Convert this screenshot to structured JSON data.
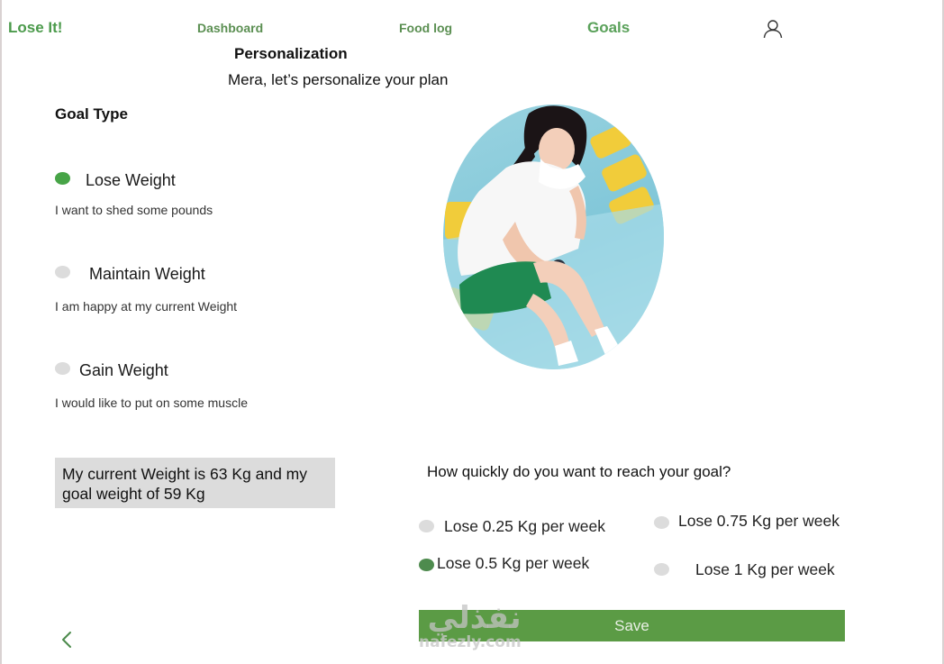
{
  "app": {
    "name": "Lose It!"
  },
  "nav": {
    "dashboard": "Dashboard",
    "food_log": "Food log",
    "goals": "Goals",
    "profile_icon": "user-icon"
  },
  "header": {
    "title": "Personalization",
    "subtitle": "Mera, let’s  personalize your plan"
  },
  "goal_type": {
    "title": "Goal Type",
    "options": [
      {
        "label": "Lose Weight",
        "description": "I want to shed some pounds",
        "selected": true
      },
      {
        "label": "Maintain Weight",
        "description": "I am happy at my current Weight",
        "selected": false
      },
      {
        "label": "Gain Weight",
        "description": "I would like to put on some muscle",
        "selected": false
      }
    ]
  },
  "weight_summary": "My current Weight is 63 Kg and my goal weight of 59 Kg",
  "pace": {
    "question": "How quickly do you want to reach your goal?",
    "options": [
      {
        "label": "Lose 0.25 Kg per week",
        "selected": false
      },
      {
        "label": "Lose 0.75 Kg per week",
        "selected": false
      },
      {
        "label": "Lose 0.5 Kg per week",
        "selected": true
      },
      {
        "label": "Lose 1 Kg per week",
        "selected": false
      }
    ]
  },
  "actions": {
    "save": "Save",
    "back_icon": "chevron-left-icon"
  },
  "watermark": {
    "arabic": "نفذلي",
    "latin": "nafezly.com"
  },
  "colors": {
    "brand_green": "#4b9a4b",
    "radio_selected": "#47a447",
    "radio_unselected": "#dcdcdc",
    "save_button": "#5b9b45",
    "summary_box": "#dcdcdc"
  }
}
